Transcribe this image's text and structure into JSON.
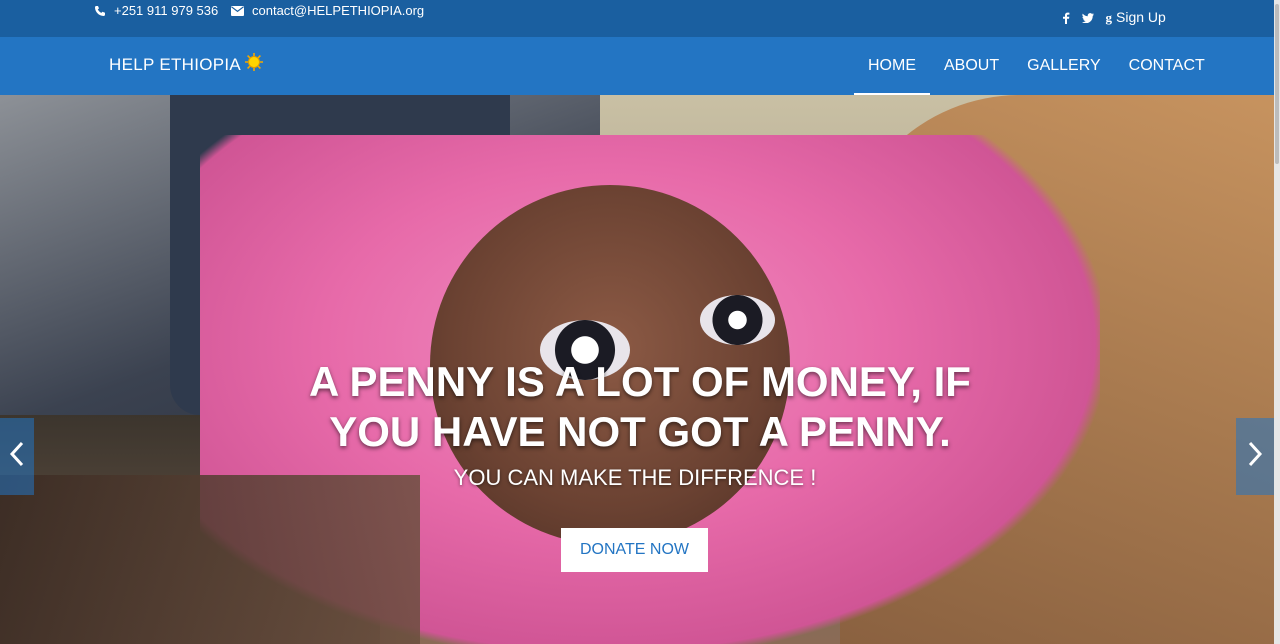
{
  "topbar": {
    "phone": "+251 911 979 536",
    "email": "contact@HELPETHIOPIA.org",
    "social": [
      "f",
      "twitter-icon",
      "g"
    ],
    "signup": "Sign Up"
  },
  "navbar": {
    "brand": "HELP ETHIOPIA",
    "links": [
      {
        "label": "HOME",
        "active": true
      },
      {
        "label": "ABOUT"
      },
      {
        "label": "GALLERY"
      },
      {
        "label": "CONTACT"
      }
    ]
  },
  "hero": {
    "headline": "A PENNY IS A LOT OF MONEY, IF YOU HAVE NOT GOT A PENNY.",
    "subline": "YOU CAN MAKE THE DIFFRENCE !",
    "button": "DONATE NOW"
  },
  "colors": {
    "topbar": "#1a5fa0",
    "navbar": "#2375c3",
    "accent": "#2375c3"
  },
  "icons": {
    "phone": "phone-icon",
    "mail": "mail-icon",
    "brand": "sun-icon",
    "prev": "chevron-left-icon",
    "next": "chevron-right-icon"
  }
}
